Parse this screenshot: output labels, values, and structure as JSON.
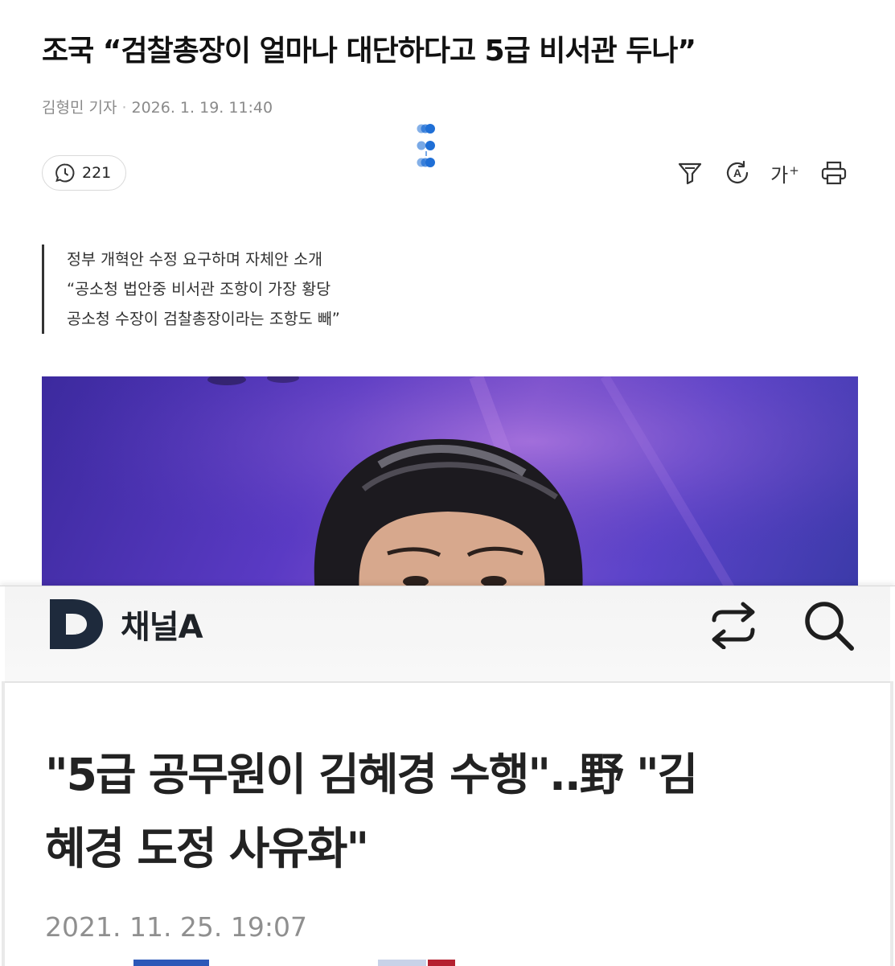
{
  "top_article": {
    "headline": "조국 “검찰총장이 얼마나 대단하다고 5급 비서관 두나”",
    "author": "김형민 기자",
    "datetime": "2026. 1. 19. 11:40",
    "comment_count": "221",
    "font_size_label": "가",
    "font_size_plus": "+",
    "summary_lines": [
      "정부 개혁안 수정 요구하며 자체안 소개",
      "“공소청 법안중 비서관 조항이 가장 황당",
      "공소청 수장이 검찰총장이라는 조항도 빼”"
    ],
    "icons": [
      "comment-icon",
      "filter-icon",
      "translate-icon",
      "font-size-icon",
      "print-icon"
    ],
    "accent_color": "#1f6fd6"
  },
  "bottom_article": {
    "brand_letter": "D",
    "brand_name": "채널A",
    "headline_lines": [
      "\"5급 공무원이 김혜경 수행\"..野 \"김",
      "혜경 도정 사유화\""
    ],
    "datetime": "2021. 11. 25. 19:07",
    "icons": [
      "share-icon",
      "search-icon"
    ],
    "brand_color": "#1e2a3c"
  }
}
